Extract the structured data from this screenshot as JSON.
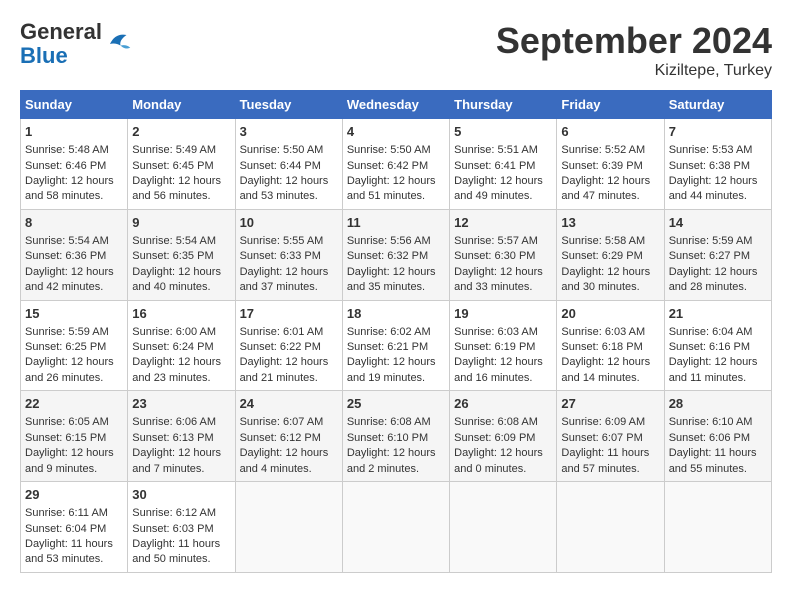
{
  "logo": {
    "text_general": "General",
    "text_blue": "Blue"
  },
  "header": {
    "month": "September 2024",
    "location": "Kiziltepe, Turkey"
  },
  "weekdays": [
    "Sunday",
    "Monday",
    "Tuesday",
    "Wednesday",
    "Thursday",
    "Friday",
    "Saturday"
  ],
  "weeks": [
    [
      {
        "day": "1",
        "sunrise": "Sunrise: 5:48 AM",
        "sunset": "Sunset: 6:46 PM",
        "daylight": "Daylight: 12 hours and 58 minutes."
      },
      {
        "day": "2",
        "sunrise": "Sunrise: 5:49 AM",
        "sunset": "Sunset: 6:45 PM",
        "daylight": "Daylight: 12 hours and 56 minutes."
      },
      {
        "day": "3",
        "sunrise": "Sunrise: 5:50 AM",
        "sunset": "Sunset: 6:44 PM",
        "daylight": "Daylight: 12 hours and 53 minutes."
      },
      {
        "day": "4",
        "sunrise": "Sunrise: 5:50 AM",
        "sunset": "Sunset: 6:42 PM",
        "daylight": "Daylight: 12 hours and 51 minutes."
      },
      {
        "day": "5",
        "sunrise": "Sunrise: 5:51 AM",
        "sunset": "Sunset: 6:41 PM",
        "daylight": "Daylight: 12 hours and 49 minutes."
      },
      {
        "day": "6",
        "sunrise": "Sunrise: 5:52 AM",
        "sunset": "Sunset: 6:39 PM",
        "daylight": "Daylight: 12 hours and 47 minutes."
      },
      {
        "day": "7",
        "sunrise": "Sunrise: 5:53 AM",
        "sunset": "Sunset: 6:38 PM",
        "daylight": "Daylight: 12 hours and 44 minutes."
      }
    ],
    [
      {
        "day": "8",
        "sunrise": "Sunrise: 5:54 AM",
        "sunset": "Sunset: 6:36 PM",
        "daylight": "Daylight: 12 hours and 42 minutes."
      },
      {
        "day": "9",
        "sunrise": "Sunrise: 5:54 AM",
        "sunset": "Sunset: 6:35 PM",
        "daylight": "Daylight: 12 hours and 40 minutes."
      },
      {
        "day": "10",
        "sunrise": "Sunrise: 5:55 AM",
        "sunset": "Sunset: 6:33 PM",
        "daylight": "Daylight: 12 hours and 37 minutes."
      },
      {
        "day": "11",
        "sunrise": "Sunrise: 5:56 AM",
        "sunset": "Sunset: 6:32 PM",
        "daylight": "Daylight: 12 hours and 35 minutes."
      },
      {
        "day": "12",
        "sunrise": "Sunrise: 5:57 AM",
        "sunset": "Sunset: 6:30 PM",
        "daylight": "Daylight: 12 hours and 33 minutes."
      },
      {
        "day": "13",
        "sunrise": "Sunrise: 5:58 AM",
        "sunset": "Sunset: 6:29 PM",
        "daylight": "Daylight: 12 hours and 30 minutes."
      },
      {
        "day": "14",
        "sunrise": "Sunrise: 5:59 AM",
        "sunset": "Sunset: 6:27 PM",
        "daylight": "Daylight: 12 hours and 28 minutes."
      }
    ],
    [
      {
        "day": "15",
        "sunrise": "Sunrise: 5:59 AM",
        "sunset": "Sunset: 6:25 PM",
        "daylight": "Daylight: 12 hours and 26 minutes."
      },
      {
        "day": "16",
        "sunrise": "Sunrise: 6:00 AM",
        "sunset": "Sunset: 6:24 PM",
        "daylight": "Daylight: 12 hours and 23 minutes."
      },
      {
        "day": "17",
        "sunrise": "Sunrise: 6:01 AM",
        "sunset": "Sunset: 6:22 PM",
        "daylight": "Daylight: 12 hours and 21 minutes."
      },
      {
        "day": "18",
        "sunrise": "Sunrise: 6:02 AM",
        "sunset": "Sunset: 6:21 PM",
        "daylight": "Daylight: 12 hours and 19 minutes."
      },
      {
        "day": "19",
        "sunrise": "Sunrise: 6:03 AM",
        "sunset": "Sunset: 6:19 PM",
        "daylight": "Daylight: 12 hours and 16 minutes."
      },
      {
        "day": "20",
        "sunrise": "Sunrise: 6:03 AM",
        "sunset": "Sunset: 6:18 PM",
        "daylight": "Daylight: 12 hours and 14 minutes."
      },
      {
        "day": "21",
        "sunrise": "Sunrise: 6:04 AM",
        "sunset": "Sunset: 6:16 PM",
        "daylight": "Daylight: 12 hours and 11 minutes."
      }
    ],
    [
      {
        "day": "22",
        "sunrise": "Sunrise: 6:05 AM",
        "sunset": "Sunset: 6:15 PM",
        "daylight": "Daylight: 12 hours and 9 minutes."
      },
      {
        "day": "23",
        "sunrise": "Sunrise: 6:06 AM",
        "sunset": "Sunset: 6:13 PM",
        "daylight": "Daylight: 12 hours and 7 minutes."
      },
      {
        "day": "24",
        "sunrise": "Sunrise: 6:07 AM",
        "sunset": "Sunset: 6:12 PM",
        "daylight": "Daylight: 12 hours and 4 minutes."
      },
      {
        "day": "25",
        "sunrise": "Sunrise: 6:08 AM",
        "sunset": "Sunset: 6:10 PM",
        "daylight": "Daylight: 12 hours and 2 minutes."
      },
      {
        "day": "26",
        "sunrise": "Sunrise: 6:08 AM",
        "sunset": "Sunset: 6:09 PM",
        "daylight": "Daylight: 12 hours and 0 minutes."
      },
      {
        "day": "27",
        "sunrise": "Sunrise: 6:09 AM",
        "sunset": "Sunset: 6:07 PM",
        "daylight": "Daylight: 11 hours and 57 minutes."
      },
      {
        "day": "28",
        "sunrise": "Sunrise: 6:10 AM",
        "sunset": "Sunset: 6:06 PM",
        "daylight": "Daylight: 11 hours and 55 minutes."
      }
    ],
    [
      {
        "day": "29",
        "sunrise": "Sunrise: 6:11 AM",
        "sunset": "Sunset: 6:04 PM",
        "daylight": "Daylight: 11 hours and 53 minutes."
      },
      {
        "day": "30",
        "sunrise": "Sunrise: 6:12 AM",
        "sunset": "Sunset: 6:03 PM",
        "daylight": "Daylight: 11 hours and 50 minutes."
      },
      null,
      null,
      null,
      null,
      null
    ]
  ]
}
